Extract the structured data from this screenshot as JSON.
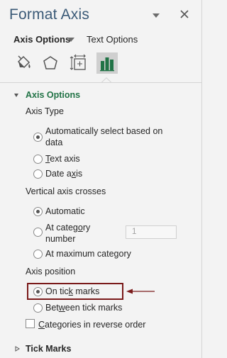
{
  "pane": {
    "title": "Format Axis",
    "tabs": {
      "axis_options": "Axis Options",
      "text_options": "Text Options"
    },
    "icons": [
      "fill-line-icon",
      "effects-icon",
      "size-properties-icon",
      "axis-options-icon"
    ]
  },
  "axis_options_section": {
    "header": "Axis Options",
    "axis_type": {
      "label": "Axis Type",
      "options": [
        {
          "label_line1": "Automatically select based on",
          "label_line2": "data",
          "selected": true
        },
        {
          "label_pre": "",
          "accel": "T",
          "label_post": "ext axis",
          "selected": false
        },
        {
          "label_pre": "Date a",
          "accel": "x",
          "label_post": "is",
          "selected": false
        }
      ]
    },
    "vertical_axis_crosses": {
      "label": "Vertical axis crosses",
      "options": [
        {
          "label": "Automatic",
          "selected": true
        },
        {
          "label_pre": "At categ",
          "accel": "o",
          "label_post": "ry",
          "label_line2": "number",
          "selected": false,
          "value": "1"
        },
        {
          "label": "At maximum category",
          "selected": false
        }
      ]
    },
    "axis_position": {
      "label": "Axis position",
      "options": [
        {
          "label_pre": "On tic",
          "accel": "k",
          "label_post": " marks",
          "selected": true
        },
        {
          "label_pre": "Bet",
          "accel": "w",
          "label_post": "een tick marks",
          "selected": false
        }
      ]
    },
    "reverse_order": {
      "label_pre": "",
      "accel": "C",
      "label_post": "ategories in reverse order",
      "checked": false
    }
  },
  "tick_marks_section": {
    "header": "Tick Marks"
  },
  "colors": {
    "title": "#3b5a77",
    "section_green": "#217346",
    "highlight": "#7a1a1a"
  }
}
